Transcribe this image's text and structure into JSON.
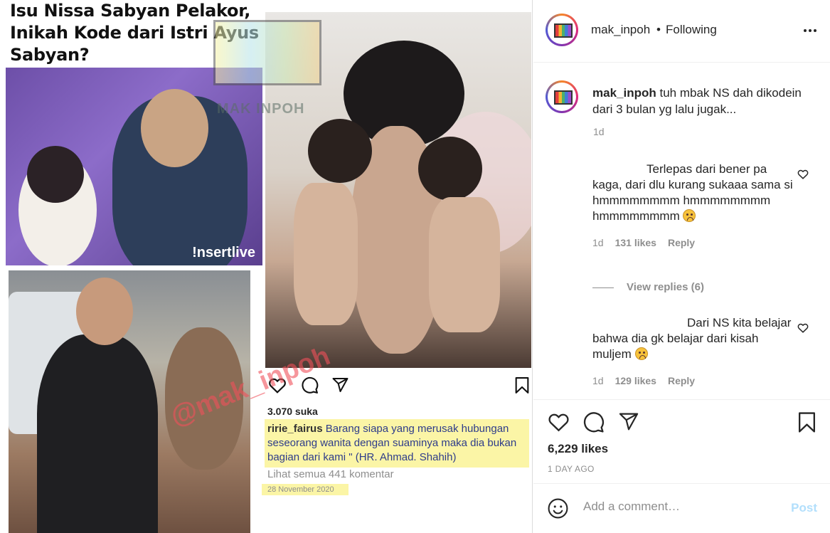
{
  "post_image": {
    "headline": "Isu Nissa Sabyan Pelakor, Inikah Kode dari Istri Ayus Sabyan?",
    "photo_credit": "!nsertlive",
    "watermark_small": "MAK INPOH",
    "watermark_big": "@mak_inpoh",
    "inner_post": {
      "likes": "3.070 suka",
      "caption_user": "ririe_fairus",
      "caption_text": " Barang siapa yang merusak hubungan seseorang wanita dengan suaminya maka dia bukan bagian dari kami \" (HR. Ahmad. Shahih)",
      "view_all": "Lihat semua 441 komentar",
      "date": "28 November 2020"
    }
  },
  "header": {
    "username": "mak_inpoh",
    "separator": "•",
    "follow_status": "Following",
    "more_icon": "more-horizontal-icon"
  },
  "caption": {
    "username": "mak_inpoh",
    "text": " tuh mbak NS dah dikodein dari 3 bulan yg lalu jugak...",
    "time": "1d"
  },
  "comments": [
    {
      "text": "Terlepas dari bener pa kaga, dari dlu kurang sukaaa sama si hmmmmmmmm hmmmmmmmm hmmmmmmmm",
      "emoji": "sad-face-emoji",
      "time": "1d",
      "likes": "131 likes",
      "reply_label": "Reply"
    },
    {
      "text": "Dari NS kita belajar bahwa dia gk belajar dari kisah muljem",
      "emoji": "sad-face-emoji",
      "time": "1d",
      "likes": "129 likes",
      "reply_label": "Reply"
    }
  ],
  "view_replies": "View replies (6)",
  "actions": {
    "likes": "6,229 likes",
    "time_ago": "1 DAY AGO"
  },
  "add_comment": {
    "placeholder": "Add a comment…",
    "post_label": "Post"
  },
  "colors": {
    "link_disabled": "#b2dffc",
    "secondary_text": "#8e8e8e",
    "highlight": "#fbf5a6"
  }
}
